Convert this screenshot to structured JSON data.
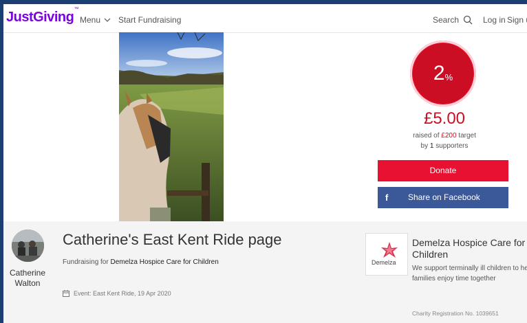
{
  "header": {
    "logo": "JustGiving",
    "logo_tm": "™",
    "menu_label": "Menu",
    "start_fundraising": "Start Fundraising",
    "search_label": "Search",
    "login": "Log in",
    "signup": "Sign u"
  },
  "progress": {
    "percent": "2",
    "percent_sign": "%",
    "raised": "£5.00",
    "raised_of": "raised of",
    "target_amount": "£200",
    "target_word": "target",
    "by": "by",
    "supporters_count": "1",
    "supporters_word": "supporters"
  },
  "actions": {
    "donate": "Donate",
    "share_facebook": "Share on Facebook",
    "facebook_icon": "f"
  },
  "page": {
    "title": "Catherine's East Kent Ride page",
    "fundraising_for_label": "Fundraising for",
    "charity_link": "Demelza Hospice Care for Children",
    "event": "Event: East Kent Ride, 19 Apr 2020"
  },
  "owner": {
    "first_name": "Catherine",
    "last_name": "Walton"
  },
  "charity": {
    "name": "Demelza Hospice Care for Children",
    "description_line1": "We support terminally ill children to he",
    "description_line2": "families enjoy time together",
    "registration": "Charity Registration No. 1039651",
    "logo_text": "Demelza"
  },
  "colors": {
    "brand_purple": "#7a04dd",
    "donate_red": "#e81131",
    "facebook_blue": "#3b5998",
    "progress_red": "#cc0e25"
  }
}
